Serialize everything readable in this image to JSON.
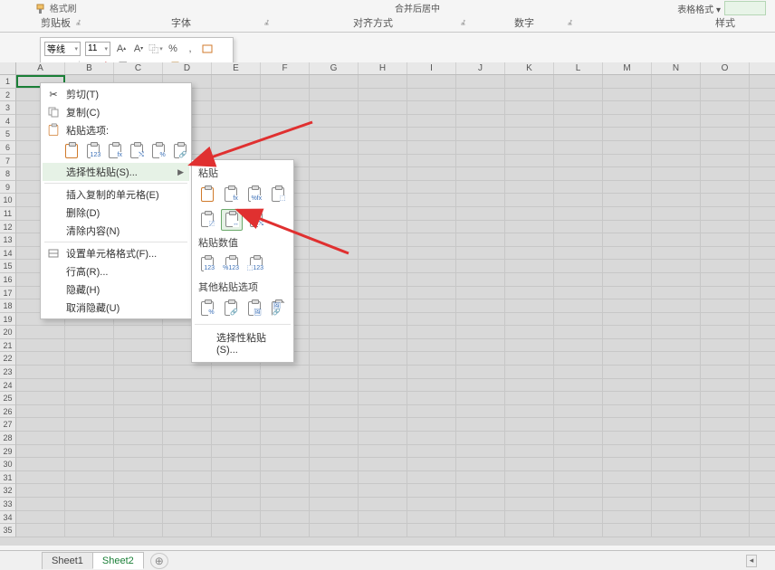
{
  "ribbon": {
    "format_painter": "格式刷",
    "groups": {
      "clipboard": "剪贴板",
      "font": "字体",
      "alignment": "对齐方式",
      "number": "数字",
      "styles": "样式"
    },
    "merge_center": "合并后居中",
    "table_format": "表格格式 ▾"
  },
  "mini_toolbar": {
    "font_name": "等线",
    "font_size": "11"
  },
  "columns": [
    "A",
    "B",
    "C",
    "D",
    "E",
    "F",
    "G",
    "H",
    "I",
    "J",
    "K",
    "L",
    "M",
    "N",
    "O"
  ],
  "context_menu": {
    "cut": "剪切(T)",
    "copy": "复制(C)",
    "paste_options": "粘贴选项:",
    "special_paste": "选择性粘贴(S)...",
    "insert_copied": "插入复制的单元格(E)",
    "delete": "删除(D)",
    "clear_contents": "清除内容(N)",
    "format_cells": "设置单元格格式(F)...",
    "row_height": "行高(R)...",
    "hide": "隐藏(H)",
    "unhide": "取消隐藏(U)"
  },
  "paste_submenu": {
    "paste": "粘贴",
    "paste_values": "粘贴数值",
    "other_paste": "其他粘贴选项",
    "special": "选择性粘贴(S)..."
  },
  "sheets": {
    "s1": "Sheet1",
    "s2": "Sheet2"
  }
}
